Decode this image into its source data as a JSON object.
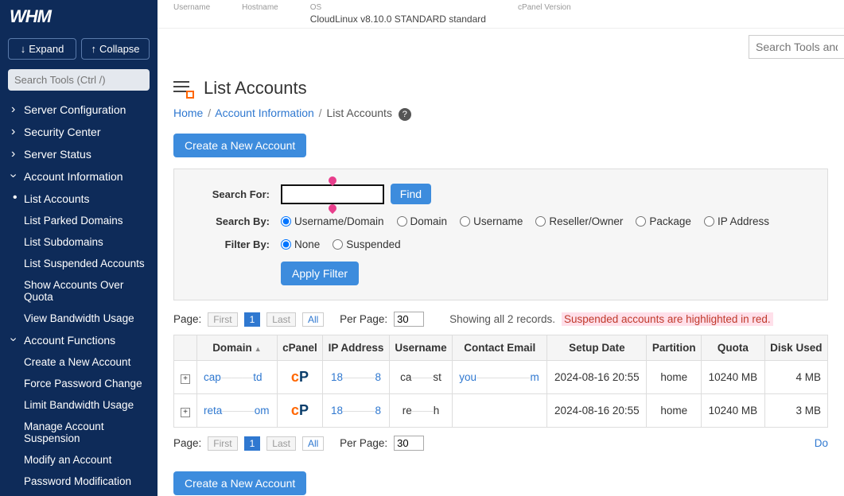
{
  "topbar": {
    "labels": {
      "username": "Username",
      "hostname": "Hostname",
      "os": "OS",
      "cpver": "cPanel Version"
    },
    "os_value": "CloudLinux v8.10.0 STANDARD standard"
  },
  "search_tools_placeholder": "Search Tools and Ac",
  "sidebar": {
    "logo": "WHM",
    "expand": "Expand",
    "collapse": "Collapse",
    "search_placeholder": "Search Tools (Ctrl /)",
    "items": [
      {
        "label": "Server Configuration",
        "type": "section"
      },
      {
        "label": "Security Center",
        "type": "section"
      },
      {
        "label": "Server Status",
        "type": "section"
      },
      {
        "label": "Account Information",
        "type": "expanded"
      },
      {
        "label": "List Accounts",
        "type": "active"
      },
      {
        "label": "List Parked Domains",
        "type": "sub"
      },
      {
        "label": "List Subdomains",
        "type": "sub"
      },
      {
        "label": "List Suspended Accounts",
        "type": "sub"
      },
      {
        "label": "Show Accounts Over Quota",
        "type": "sub"
      },
      {
        "label": "View Bandwidth Usage",
        "type": "sub"
      },
      {
        "label": "Account Functions",
        "type": "expanded"
      },
      {
        "label": "Create a New Account",
        "type": "sub"
      },
      {
        "label": "Force Password Change",
        "type": "sub"
      },
      {
        "label": "Limit Bandwidth Usage",
        "type": "sub"
      },
      {
        "label": "Manage Account Suspension",
        "type": "sub"
      },
      {
        "label": "Modify an Account",
        "type": "sub"
      },
      {
        "label": "Password Modification",
        "type": "sub"
      }
    ]
  },
  "page": {
    "title": "List Accounts",
    "breadcrumb": {
      "home": "Home",
      "info": "Account Information",
      "current": "List Accounts"
    },
    "create_btn": "Create a New Account",
    "filter": {
      "search_for": "Search For:",
      "find": "Find",
      "search_by": "Search By:",
      "opts_by": [
        "Username/Domain",
        "Domain",
        "Username",
        "Reseller/Owner",
        "Package",
        "IP Address"
      ],
      "filter_by": "Filter By:",
      "opts_filter": [
        "None",
        "Suspended"
      ],
      "apply": "Apply Filter"
    },
    "pager": {
      "page_label": "Page:",
      "first": "First",
      "num": "1",
      "last": "Last",
      "all": "All",
      "per_page": "Per Page:",
      "per_page_val": "30",
      "showing": "Showing all 2 records.",
      "suspended_note": "Suspended accounts are highlighted in red.",
      "do": "Do"
    },
    "table": {
      "headers": [
        "Domain",
        "cPanel",
        "IP Address",
        "Username",
        "Contact Email",
        "Setup Date",
        "Partition",
        "Quota",
        "Disk Used"
      ],
      "rows": [
        {
          "domain_a": "cap",
          "domain_b": "td",
          "ip_a": "18",
          "ip_b": "8",
          "user_a": "ca",
          "user_b": "st",
          "email_a": "you",
          "email_b": "m",
          "setup": "2024-08-16 20:55",
          "partition": "home",
          "quota": "10240 MB",
          "disk": "4 MB"
        },
        {
          "domain_a": "reta",
          "domain_b": "om",
          "ip_a": "18",
          "ip_b": "8",
          "user_a": "re",
          "user_b": "h",
          "email_a": "",
          "email_b": "",
          "setup": "2024-08-16 20:55",
          "partition": "home",
          "quota": "10240 MB",
          "disk": "3 MB"
        }
      ]
    }
  }
}
